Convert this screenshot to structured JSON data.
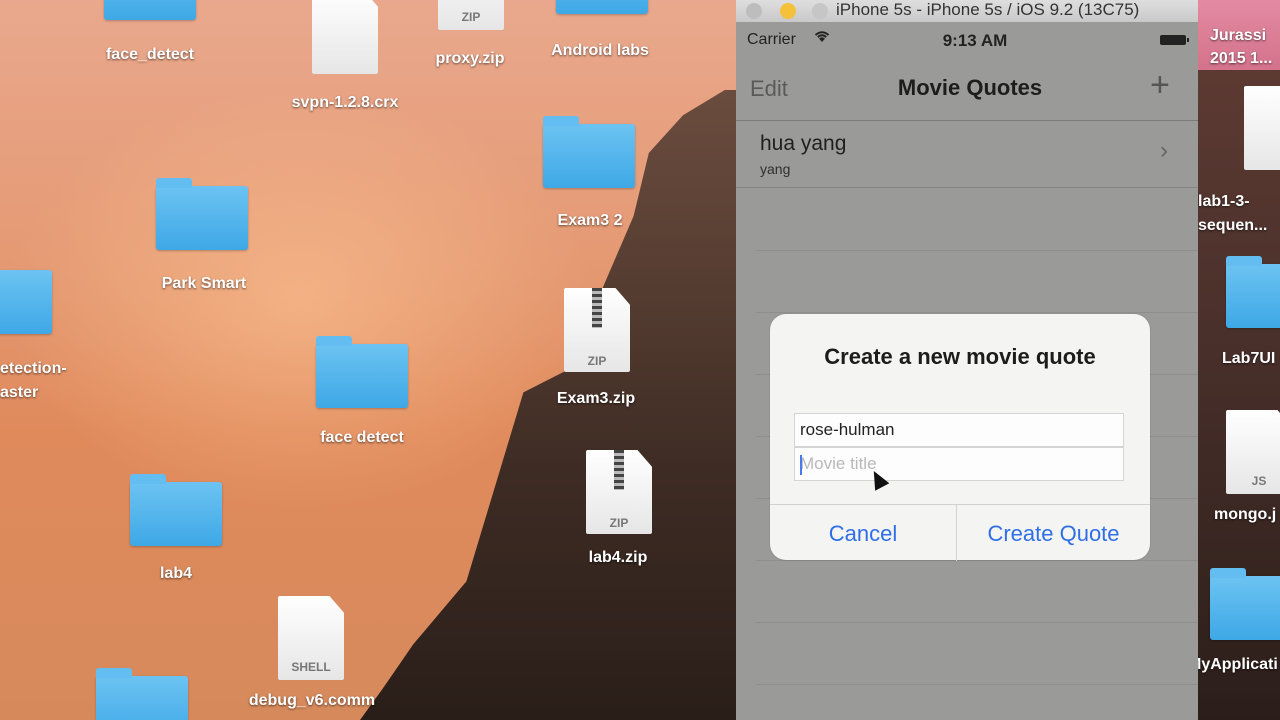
{
  "desktop": {
    "items": [
      {
        "label": "face_detect",
        "kind": "folder"
      },
      {
        "label": "svpn-1.2.8.crx",
        "kind": "file"
      },
      {
        "label": "proxy.zip",
        "kind": "zip",
        "tag": "ZIP"
      },
      {
        "label": "Android labs",
        "kind": "folder"
      },
      {
        "label": "Exam3 2",
        "kind": "folder"
      },
      {
        "label": "Park Smart",
        "kind": "folder"
      },
      {
        "label": "etection-\naster",
        "kind": "folder"
      },
      {
        "label": "face detect",
        "kind": "folder"
      },
      {
        "label": "Exam3.zip",
        "kind": "zip",
        "tag": "ZIP"
      },
      {
        "label": "lab4",
        "kind": "folder"
      },
      {
        "label": "lab4.zip",
        "kind": "zip",
        "tag": "ZIP"
      },
      {
        "label": "debug_v6.comm",
        "kind": "file",
        "tag": "SHELL"
      }
    ],
    "right_items": [
      {
        "label": "Jurassi\n2015 1..."
      },
      {
        "label": "lab1-3-\nsequen..."
      },
      {
        "label": "Lab7UI"
      },
      {
        "label": "mongo.j",
        "tag": "JS"
      },
      {
        "label": "MyApplicati"
      }
    ]
  },
  "simulator": {
    "window_title": "iPhone 5s - iPhone 5s / iOS 9.2 (13C75)",
    "status": {
      "carrier": "Carrier",
      "time": "9:13 AM"
    },
    "navbar": {
      "edit_label": "Edit",
      "title": "Movie Quotes",
      "add_label": "+"
    },
    "rows": [
      {
        "title": "hua yang",
        "subtitle": "yang"
      }
    ],
    "alert": {
      "title": "Create a new movie quote",
      "quote_value": "rose-hulman",
      "movie_placeholder": "Movie title",
      "cancel_label": "Cancel",
      "create_label": "Create Quote"
    }
  },
  "colors": {
    "accent": "#2f6fe6",
    "folder": "#4fb4ec"
  }
}
